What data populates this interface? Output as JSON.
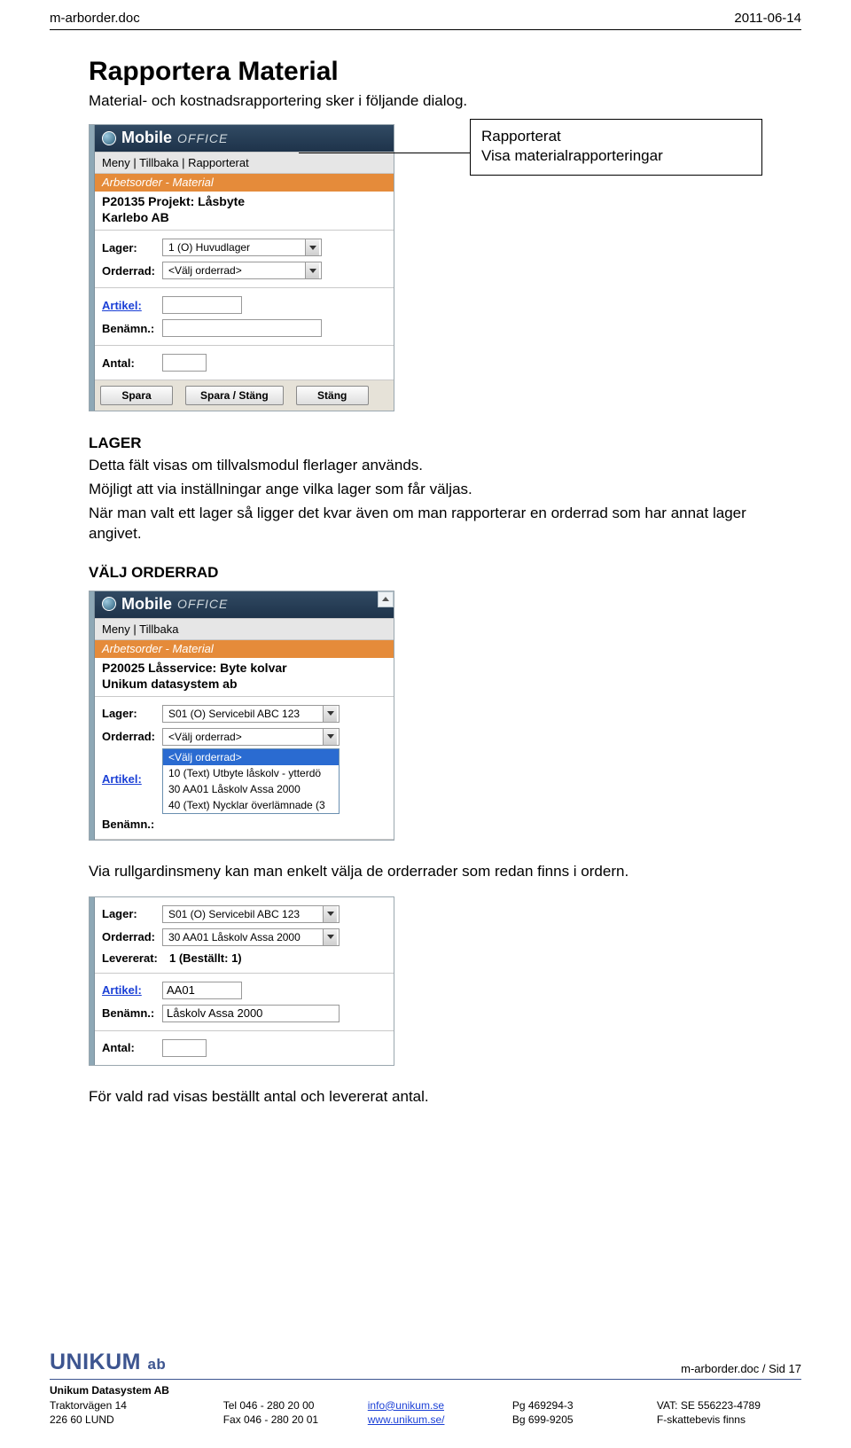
{
  "header": {
    "filename": "m-arborder.doc",
    "date": "2011-06-14"
  },
  "title": "Rapportera Material",
  "intro": "Material- och kostnadsrapportering sker i följande dialog.",
  "callout": {
    "line1": "Rapporterat",
    "line2": "Visa materialrapporteringar"
  },
  "panel1": {
    "header_brand": "Mobile",
    "header_brand2": "OFFICE",
    "menu": "Meny | Tillbaka | Rapporterat",
    "sub": "Arbetsorder - Material",
    "project": "P20135 Projekt: Låsbyte",
    "customer": "Karlebo AB",
    "labels": {
      "lager": "Lager:",
      "orderrad": "Orderrad:",
      "artikel": "Artikel:",
      "benamn": "Benämn.:",
      "antal": "Antal:"
    },
    "lager_value": "1 (O) Huvudlager",
    "orderrad_value": "<Välj orderrad>",
    "buttons": {
      "spara": "Spara",
      "spara_stang": "Spara / Stäng",
      "stang": "Stäng"
    }
  },
  "sec_lager": {
    "heading": "LAGER",
    "p1": "Detta fält visas om tillvalsmodul flerlager används.",
    "p2": "Möjligt att via inställningar ange vilka lager som får väljas.",
    "p3": "När man valt ett lager så ligger det kvar även om man rapporterar en orderrad som har annat lager angivet."
  },
  "sec_valj": {
    "heading": "VÄLJ ORDERRAD"
  },
  "panel2": {
    "header_brand": "Mobile",
    "header_brand2": "OFFICE",
    "menu": "Meny | Tillbaka",
    "sub": "Arbetsorder - Material",
    "project": "P20025 Låsservice: Byte kolvar",
    "customer": "Unikum datasystem ab",
    "labels": {
      "lager": "Lager:",
      "orderrad": "Orderrad:",
      "artikel": "Artikel:",
      "benamn": "Benämn.:"
    },
    "lager_value": "S01 (O) Servicebil ABC 123",
    "orderrad_value": "<Välj orderrad>",
    "options": {
      "o0": "<Välj orderrad>",
      "o1": "10 (Text) Utbyte låskolv - ytterdö",
      "o2": "30 AA01 Låskolv Assa 2000",
      "o3": "40 (Text) Nycklar överlämnade (3"
    }
  },
  "post_panel2": "Via rullgardinsmeny kan man enkelt välja de orderrader som redan finns i ordern.",
  "panel3": {
    "labels": {
      "lager": "Lager:",
      "orderrad": "Orderrad:",
      "levererat": "Levererat:",
      "artikel": "Artikel:",
      "benamn": "Benämn.:",
      "antal": "Antal:"
    },
    "lager_value": "S01 (O) Servicebil ABC 123",
    "orderrad_value": "30 AA01 Låskolv Assa 2000",
    "levererat": "1 (Beställt: 1)",
    "artikel_value": "AA01",
    "benamn_value": "Låskolv Assa 2000"
  },
  "post_panel3": "För vald rad visas beställt antal och levererat antal.",
  "footer": {
    "logo1": "UNIKUM",
    "logo2": "ab",
    "sidref": "m-arborder.doc / Sid 17",
    "company": "Unikum Datasystem AB",
    "addr1": "Traktorvägen 14",
    "addr2": "226 60  LUND",
    "tel": "Tel  046 - 280 20 00",
    "fax": "Fax  046 - 280 20 01",
    "email": "info@unikum.se",
    "web": "www.unikum.se/",
    "pg": "Pg  469294-3",
    "bg": "Bg  699-9205",
    "vat": "VAT: SE 556223-4789",
    "fskatt": "F-skattebevis finns"
  }
}
